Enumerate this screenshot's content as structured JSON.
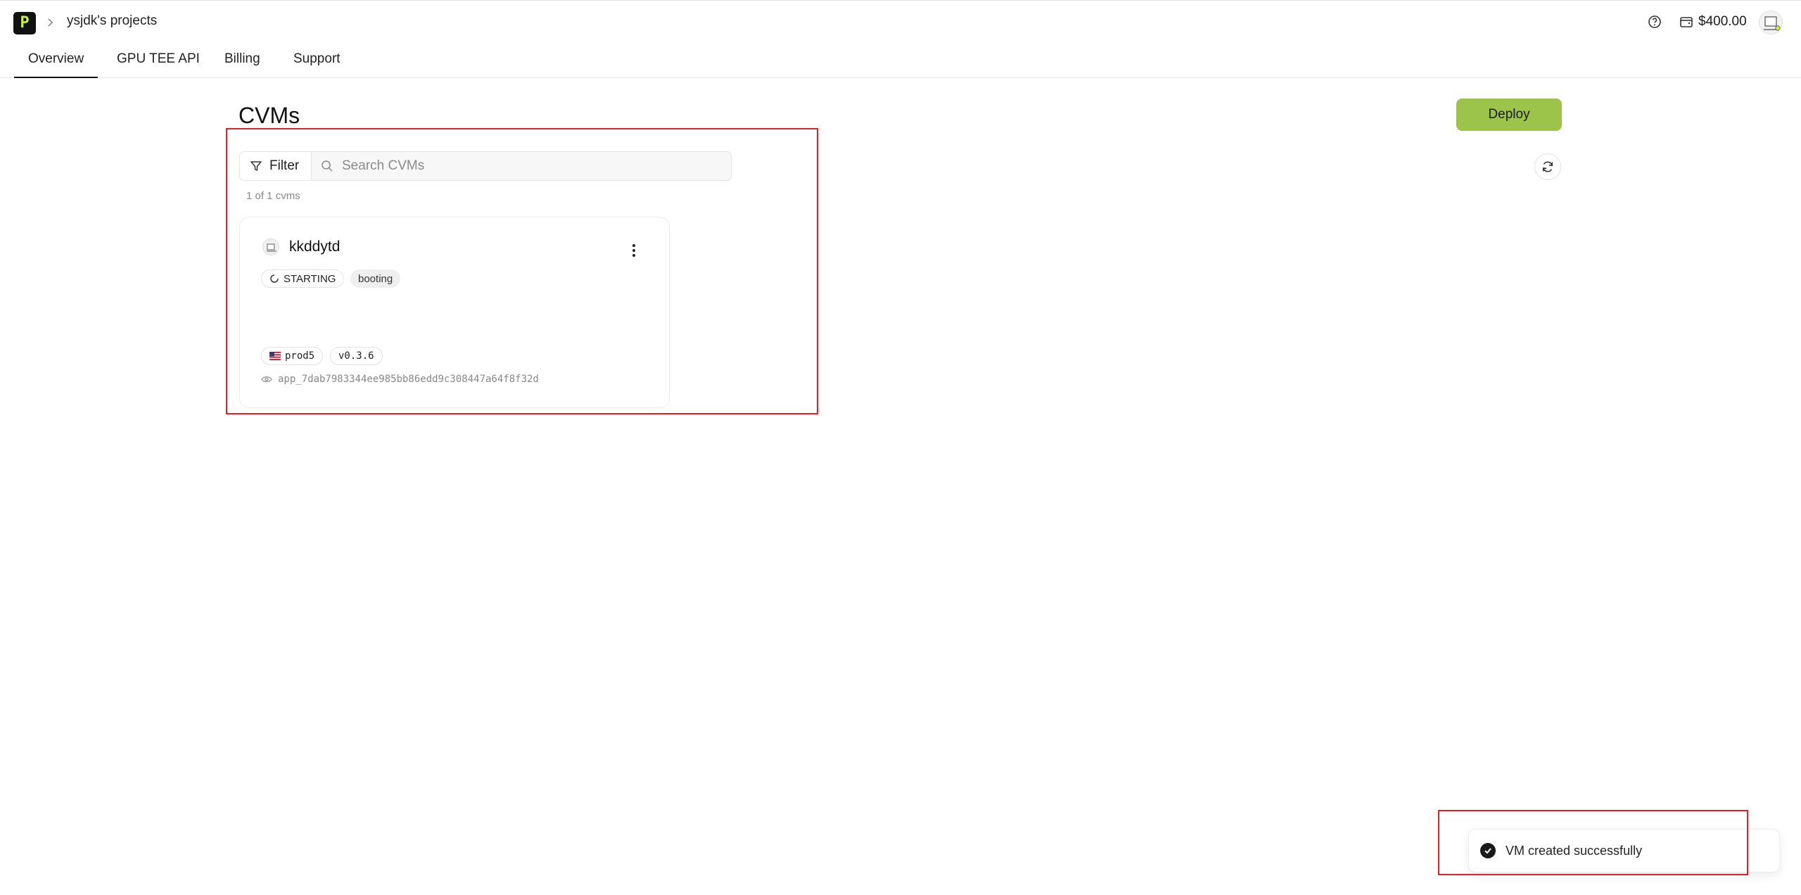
{
  "header": {
    "logo_glyph": "P",
    "breadcrumb": "ysjdk's projects",
    "balance": "$400.00",
    "icons": {
      "help": "help-circle-icon",
      "wallet": "wallet-icon",
      "avatar": "avatar"
    }
  },
  "tabs": [
    {
      "label": "Overview",
      "active": true
    },
    {
      "label": "GPU TEE API",
      "active": false
    },
    {
      "label": "Billing",
      "active": false
    },
    {
      "label": "Support",
      "active": false
    }
  ],
  "main": {
    "title": "CVMs",
    "deploy_label": "Deploy",
    "filter_label": "Filter",
    "search_placeholder": "Search CVMs",
    "count_text": "1 of 1 cvms"
  },
  "cvm": {
    "name": "kkddytd",
    "status": "STARTING",
    "state": "booting",
    "region": "prod5",
    "version": "v0.3.6",
    "app_id": "app_7dab7983344ee985bb86edd9c308447a64f8f32d"
  },
  "toast": {
    "message": "VM created successfully"
  },
  "colors": {
    "accent": "#9dc44a",
    "highlight": "#e0202a",
    "logo_bg": "#111111",
    "logo_fg": "#c8f03c"
  }
}
